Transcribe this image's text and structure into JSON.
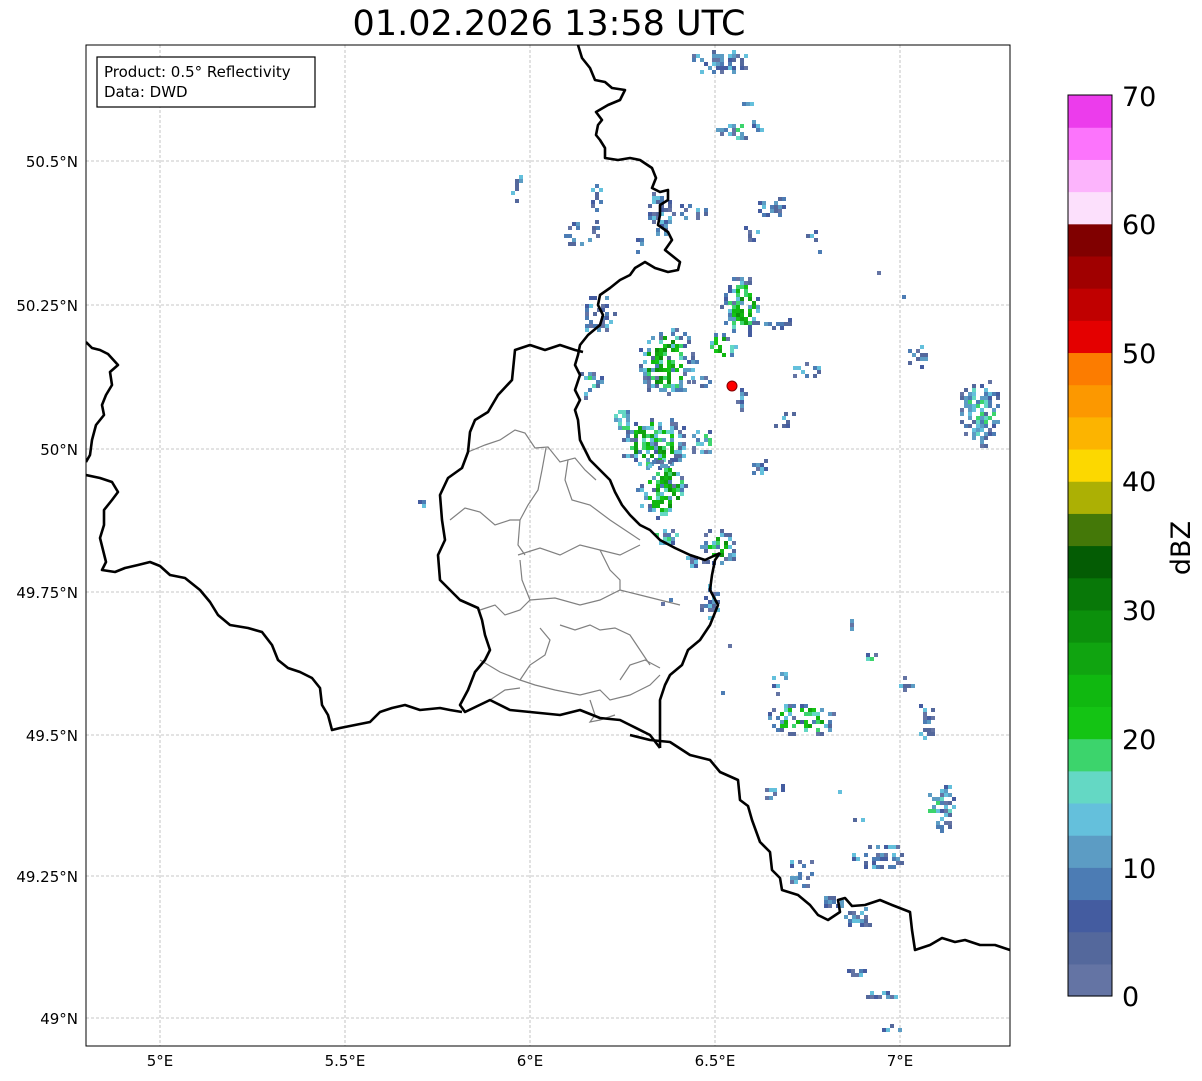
{
  "title": "01.02.2026 13:58 UTC",
  "info_box": {
    "product_line": "Product: 0.5° Reflectivity",
    "data_line": "Data: DWD"
  },
  "lat_ticks": [
    "50.5°N",
    "50.25°N",
    "50°N",
    "49.75°N",
    "49.5°N",
    "49.25°N",
    "49°N"
  ],
  "lon_ticks": [
    "5°E",
    "5.5°E",
    "6°E",
    "6.5°E",
    "7°E"
  ],
  "colorbar": {
    "label": "dBZ",
    "tick_labels": [
      "0",
      "10",
      "20",
      "30",
      "40",
      "50",
      "60",
      "70"
    ],
    "colors": [
      "#6474a4",
      "#54689c",
      "#445ca0",
      "#4c7cb4",
      "#5c9cc4",
      "#64c0dc",
      "#64d8c4",
      "#3cd46c",
      "#14c414",
      "#10b810",
      "#10a410",
      "#0c900c",
      "#087808",
      "#045c04",
      "#447808",
      "#acb004",
      "#fcd800",
      "#fcb400",
      "#fc9800",
      "#fc7c00",
      "#e40000",
      "#c00000",
      "#a00000",
      "#800000",
      "#fce0fc",
      "#fcb4fc",
      "#fc74fc",
      "#ec3cec"
    ]
  },
  "colors": {
    "border": "#000000",
    "canton_border": "#808080",
    "grid": "#b0b0b0",
    "radar_site": "#ff0000"
  },
  "map_markers": [
    {
      "name": "radar-site",
      "lon": 6.55,
      "lat": 50.11
    }
  ]
}
